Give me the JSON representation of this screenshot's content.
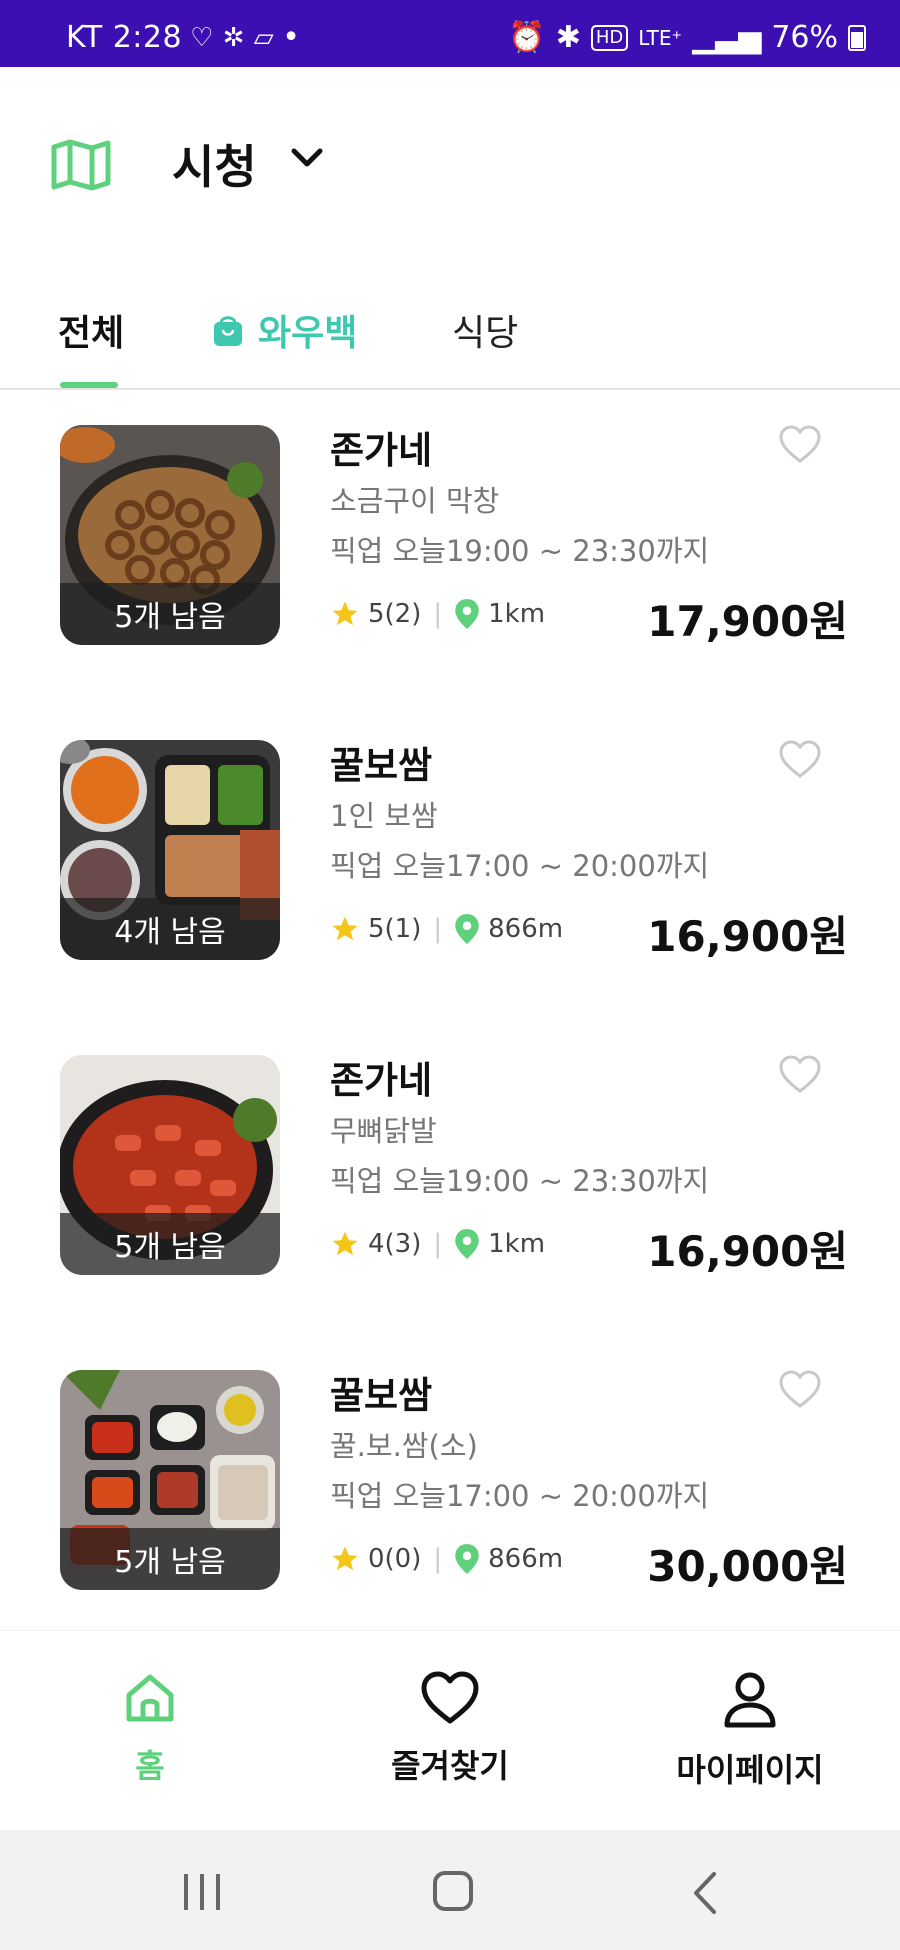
{
  "status_bar": {
    "carrier_time": "KT 2:28",
    "dot": "•",
    "network": "LTE⁺",
    "hd": "HD",
    "battery": "76%"
  },
  "header": {
    "location": "시청"
  },
  "tabs": [
    {
      "label": "전체"
    },
    {
      "label": "와우백"
    },
    {
      "label": "식당"
    }
  ],
  "items": [
    {
      "store": "존가네",
      "menu": "소금구이 막창",
      "pickup": "픽업 오늘19:00 ~ 23:30까지",
      "rating": "5(2)",
      "distance": "1km",
      "price": "17,900원",
      "stock": "5개 남음"
    },
    {
      "store": "꿀보쌈",
      "menu": "1인 보쌈",
      "pickup": "픽업 오늘17:00 ~ 20:00까지",
      "rating": "5(1)",
      "distance": "866m",
      "price": "16,900원",
      "stock": "4개 남음"
    },
    {
      "store": "존가네",
      "menu": "무뼈닭발",
      "pickup": "픽업 오늘19:00 ~ 23:30까지",
      "rating": "4(3)",
      "distance": "1km",
      "price": "16,900원",
      "stock": "5개 남음"
    },
    {
      "store": "꿀보쌈",
      "menu": "꿀.보.쌈(소)",
      "pickup": "픽업 오늘17:00 ~ 20:00까지",
      "rating": "0(0)",
      "distance": "866m",
      "price": "30,000원",
      "stock": "5개 남음"
    }
  ],
  "bottom_nav": {
    "home": "홈",
    "favorites": "즐겨찾기",
    "mypage": "마이페이지"
  },
  "colors": {
    "status_bar": "#3c0fb3",
    "accent_green": "#5fd07c",
    "wow_teal": "#3ec8b0",
    "star": "#f5c518"
  }
}
